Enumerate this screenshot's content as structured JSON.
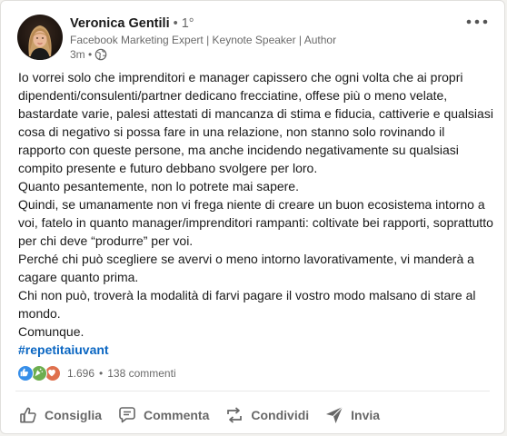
{
  "post": {
    "author": {
      "name": "Veronica Gentili",
      "degree": " • 1°",
      "headline": "Facebook Marketing Expert | Keynote Speaker | Author",
      "time": "3m •",
      "visibility_icon": "globe-icon"
    },
    "more_icon": "more-horizontal-icon",
    "body": [
      "Io vorrei solo che imprenditori e manager capissero che ogni volta che ai propri dipendenti/consulenti/partner dedicano frecciatine, offese più o meno velate, bastardate varie, palesi attestati di mancanza di stima e fiducia, cattiverie e qualsiasi cosa di negativo si possa fare in una relazione, non stanno solo rovinando il rapporto con queste persone, ma anche incidendo negativamente su qualsiasi compito presente e futuro debbano svolgere per loro.",
      "Quanto pesantemente, non lo potrete mai sapere.",
      "Quindi, se umanamente non vi frega niente di creare un buon ecosistema intorno a voi, fatelo in quanto manager/imprenditori rampanti: coltivate bei rapporti, soprattutto per chi deve “produrre” per voi.",
      "Perché chi può scegliere se avervi o meno intorno lavorativamente, vi manderà a cagare quanto prima.",
      "Chi non può, troverà la modalità di farvi pagare il vostro modo malsano di stare al mondo.",
      "Comunque."
    ],
    "hashtag": "#repetitaiuvant",
    "social": {
      "reaction_icons": [
        "like-icon",
        "celebrate-icon",
        "love-icon"
      ],
      "reactions_count": "1.696",
      "separator": "•",
      "comments": "138 commenti"
    },
    "actions": [
      {
        "label": "Consiglia",
        "icon": "thumbs-up-icon"
      },
      {
        "label": "Commenta",
        "icon": "comment-icon"
      },
      {
        "label": "Condividi",
        "icon": "repost-icon"
      },
      {
        "label": "Invia",
        "icon": "send-icon"
      }
    ]
  },
  "colors": {
    "link": "#0a66c2",
    "like": "#378fe9",
    "celebrate": "#44712e",
    "love": "#df704d"
  }
}
